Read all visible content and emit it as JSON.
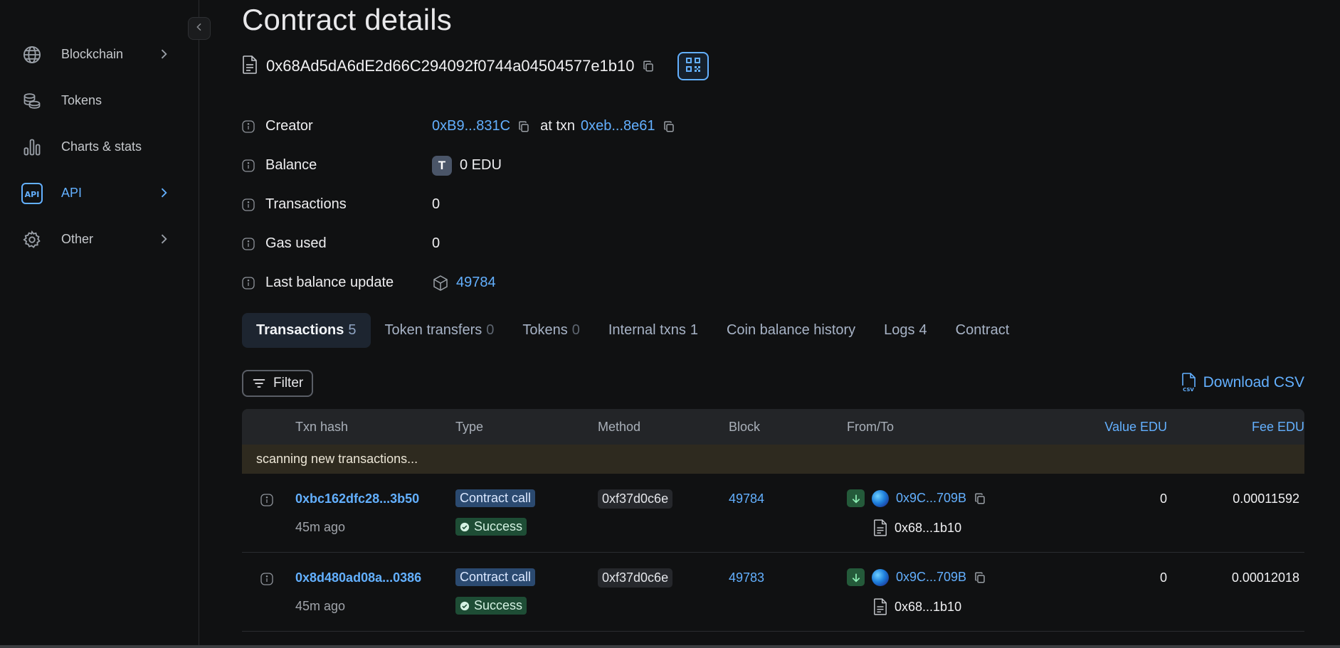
{
  "sidebar": {
    "items": [
      {
        "label": "Blockchain",
        "icon": "globe-icon",
        "has_chevron": true,
        "active": false
      },
      {
        "label": "Tokens",
        "icon": "coins-icon",
        "has_chevron": false,
        "active": false
      },
      {
        "label": "Charts & stats",
        "icon": "bar-chart-icon",
        "has_chevron": false,
        "active": false
      },
      {
        "label": "API",
        "icon": "api-icon",
        "has_chevron": true,
        "active": true
      },
      {
        "label": "Other",
        "icon": "gear-icon",
        "has_chevron": true,
        "active": false
      }
    ]
  },
  "page": {
    "title": "Contract details",
    "address": "0x68Ad5dA6dE2d66C294092f0744a04504577e1b10"
  },
  "details": {
    "creator_label": "Creator",
    "creator_address": "0xB9...831C",
    "at_txn_label": "at txn",
    "creator_txn": "0xeb...8e61",
    "balance_label": "Balance",
    "balance_token_letter": "T",
    "balance_value": "0 EDU",
    "transactions_label": "Transactions",
    "transactions_value": "0",
    "gas_label": "Gas used",
    "gas_value": "0",
    "last_update_label": "Last balance update",
    "last_update_block": "49784"
  },
  "tabs": [
    {
      "label": "Transactions",
      "count": "5",
      "active": true
    },
    {
      "label": "Token transfers",
      "count": "0",
      "active": false
    },
    {
      "label": "Tokens",
      "count": "0",
      "active": false
    },
    {
      "label": "Internal txns",
      "count": "1",
      "active": false
    },
    {
      "label": "Coin balance history",
      "count": "",
      "active": false
    },
    {
      "label": "Logs",
      "count": "4",
      "active": false
    },
    {
      "label": "Contract",
      "count": "",
      "active": false
    }
  ],
  "toolbar": {
    "filter_label": "Filter",
    "download_label": "Download CSV"
  },
  "table": {
    "headers": {
      "txn_hash": "Txn hash",
      "type": "Type",
      "method": "Method",
      "block": "Block",
      "from_to": "From/To",
      "value": "Value EDU",
      "fee": "Fee EDU"
    },
    "scanning_text": "scanning new transactions...",
    "rows": [
      {
        "hash": "0xbc162dfc28...3b50",
        "age": "45m ago",
        "type": "Contract call",
        "status": "Success",
        "method": "0xf37d0c6e",
        "block": "49784",
        "from": "0x9C...709B",
        "to": "0x68...1b10",
        "value": "0",
        "fee": "0.00011592"
      },
      {
        "hash": "0x8d480ad08a...0386",
        "age": "45m ago",
        "type": "Contract call",
        "status": "Success",
        "method": "0xf37d0c6e",
        "block": "49783",
        "from": "0x9C...709B",
        "to": "0x68...1b10",
        "value": "0",
        "fee": "0.00012018"
      }
    ]
  },
  "colors": {
    "accent": "#63b0ff",
    "background": "#101112",
    "success": "#1e4d35",
    "contract_call": "#2b4a70"
  }
}
